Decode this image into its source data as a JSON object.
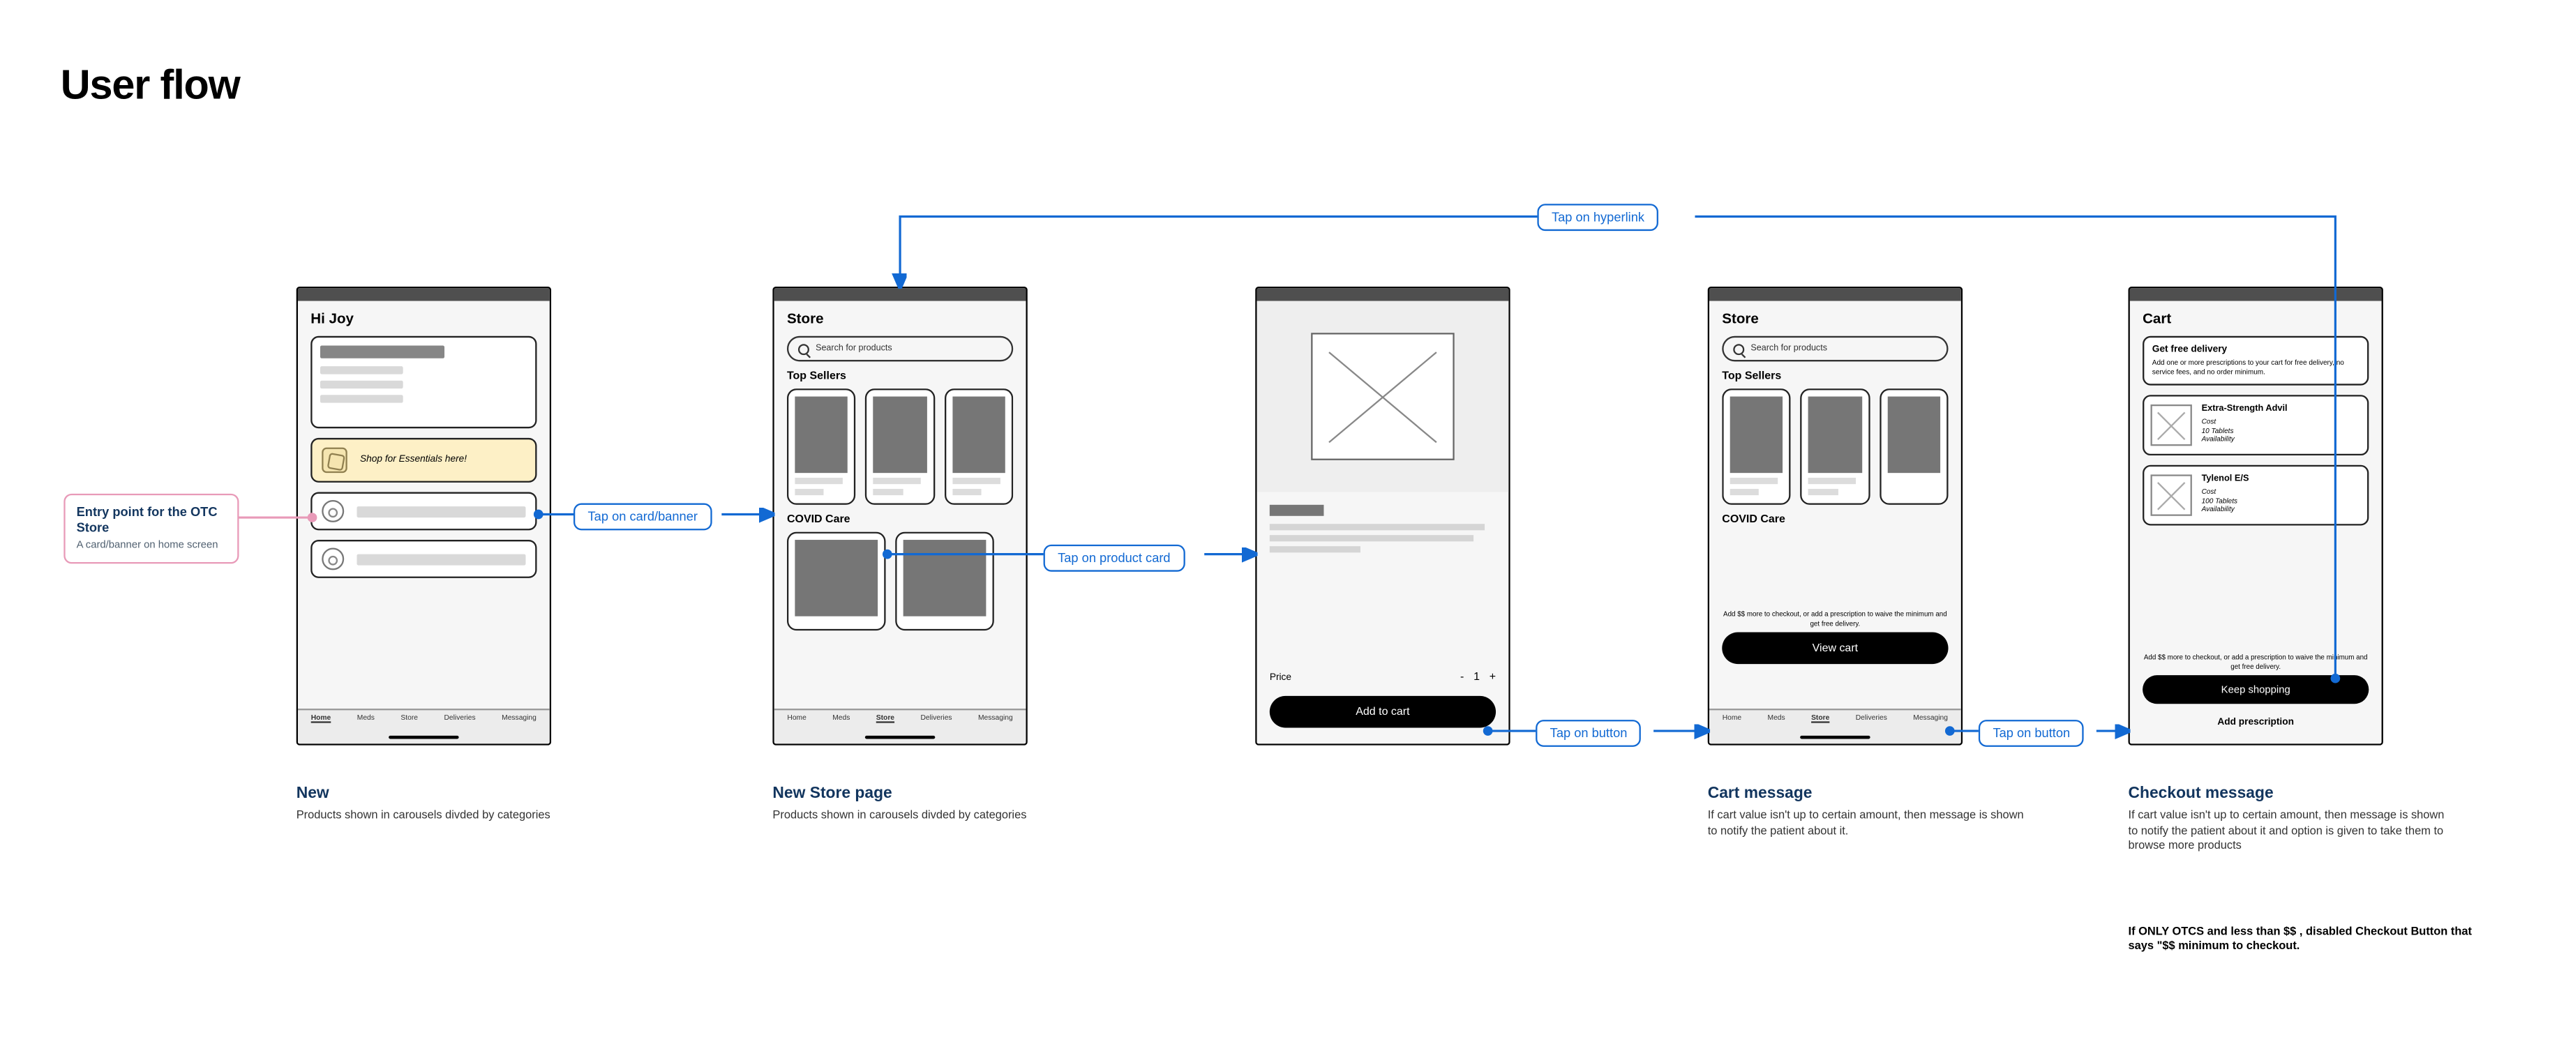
{
  "page_title": "User flow",
  "annotation_entry": {
    "title": "Entry point for the OTC Store",
    "desc": "A card/banner on home screen"
  },
  "flows": {
    "card_banner": "Tap on card/banner",
    "product_card": "Tap on product card",
    "button1": "Tap on button",
    "button2": "Tap on button",
    "hyperlink": "Tap on hyperlink"
  },
  "nav": {
    "items": [
      "Home",
      "Meds",
      "Store",
      "Deliveries",
      "Messaging"
    ]
  },
  "screen1": {
    "greeting": "Hi Joy",
    "banner_text": "Shop for Essentials here!"
  },
  "screen2": {
    "title": "Store",
    "search_placeholder": "Search for products",
    "section1": "Top Sellers",
    "section2": "COVID Care"
  },
  "screen3": {
    "price_label": "Price",
    "qty_minus": "-",
    "qty_value": "1",
    "qty_plus": "+",
    "add_to_cart": "Add to cart"
  },
  "screen4": {
    "title": "Store",
    "search_placeholder": "Search for products",
    "section1": "Top Sellers",
    "section2": "COVID Care",
    "promo": "Add $$ more to checkout, or add a prescription to waive the minimum and get free delivery.",
    "view_cart": "View cart"
  },
  "screen5": {
    "title": "Cart",
    "promo_title": "Get free delivery",
    "promo_desc": "Add one or more prescriptions to your cart for free delivery, no service fees, and no order minimum.",
    "items": [
      {
        "name": "Extra-Strength Advil",
        "l1": "Cost",
        "l2": "10 Tablets",
        "l3": "Availability"
      },
      {
        "name": "Tylenol E/S",
        "l1": "Cost",
        "l2": "100 Tablets",
        "l3": "Availability"
      }
    ],
    "bottom_promo": "Add $$ more to checkout, or add a prescription to waive the minimum and get free delivery.",
    "keep_shopping": "Keep shopping",
    "add_prescription": "Add prescription"
  },
  "captions": {
    "c1": {
      "title": "New",
      "desc": "Products shown in carousels divded by categories"
    },
    "c2": {
      "title": "New Store page",
      "desc": "Products shown in carousels divded by categories"
    },
    "c4": {
      "title": "Cart message",
      "desc": "If cart value isn't up to certain amount, then message is shown to notify the patient about it."
    },
    "c5": {
      "title": "Checkout message",
      "desc": "If cart value isn't up to certain amount, then message is shown to notify the patient about it and option is given to take them to browse more products"
    }
  },
  "footnote": "If ONLY OTCS and less than $$ , disabled Checkout Button that says \"$$ minimum to checkout."
}
